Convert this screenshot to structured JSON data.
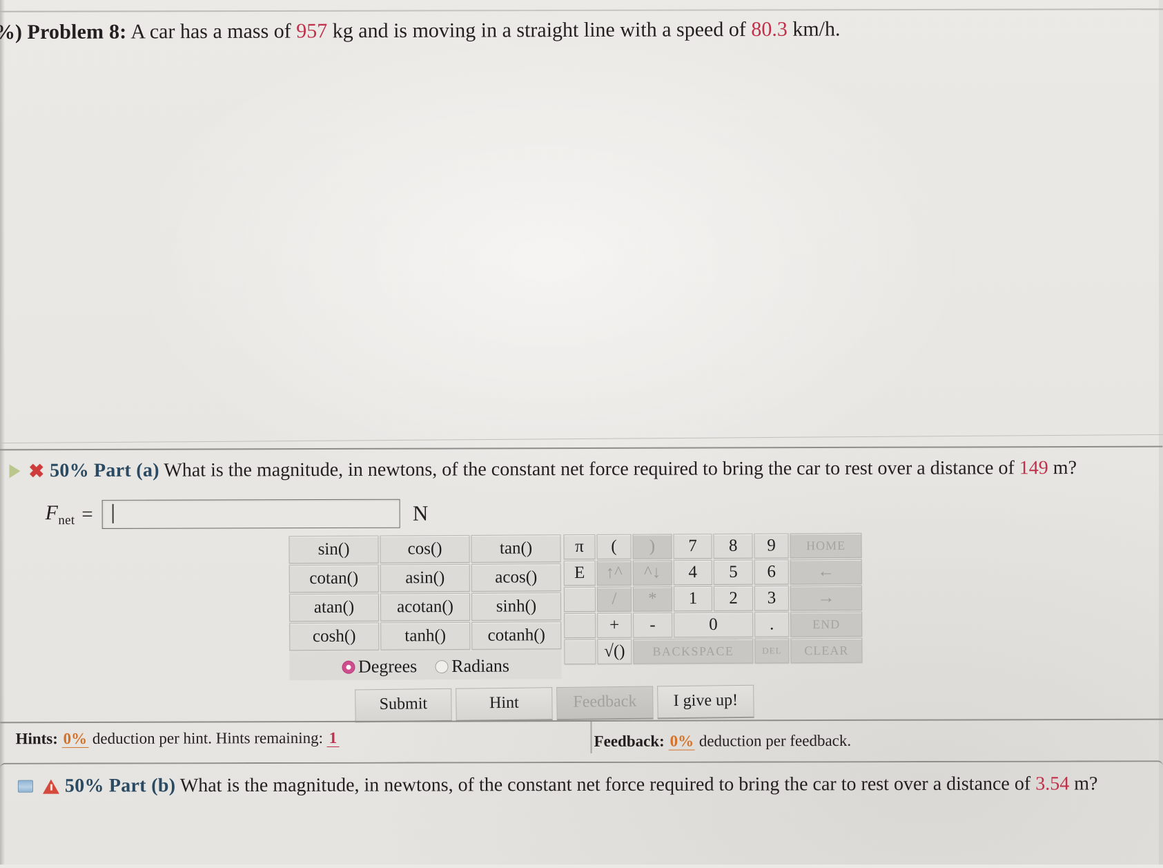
{
  "problem": {
    "percent_prefix": "%)",
    "label": "Problem 8:",
    "text_part1": "A car has a mass of",
    "mass_value": "957",
    "text_part2": "kg and is moving in a straight line with a speed of",
    "speed_value": "80.3",
    "text_part3": "km/h."
  },
  "part_a": {
    "weight": "50%",
    "title": "Part (a)",
    "question_part1": "What is the magnitude, in newtons, of the constant net force required to bring the car to rest over a distance of",
    "distance_value": "149",
    "question_part2": "m?",
    "answer": {
      "label_var": "F",
      "label_sub": "net",
      "equals": "=",
      "value": "",
      "placeholder": "",
      "unit": "N"
    },
    "status_icon": "red-x-icon",
    "expand_icon": "green-triangle-icon"
  },
  "calculator": {
    "functions": [
      [
        "sin()",
        "cos()",
        "tan()"
      ],
      [
        "cotan()",
        "asin()",
        "acos()"
      ],
      [
        "atan()",
        "acotan()",
        "sinh()"
      ],
      [
        "cosh()",
        "tanh()",
        "cotanh()"
      ]
    ],
    "angle_mode": {
      "degrees_label": "Degrees",
      "radians_label": "Radians",
      "selected": "Degrees",
      "selected_color": "#cf4f8e"
    },
    "keypad": [
      [
        "π",
        "(",
        ")",
        "7",
        "8",
        "9",
        "HOME"
      ],
      [
        "E",
        "↑^",
        "^↓",
        "4",
        "5",
        "6",
        "←"
      ],
      [
        "",
        "/",
        "*",
        "1",
        "2",
        "3",
        "→"
      ],
      [
        "",
        "+",
        "-",
        "0",
        ".",
        "END"
      ],
      [
        "",
        "√()",
        "BACKSPACE",
        "DEL",
        "CLEAR"
      ]
    ],
    "keys": {
      "pi": "π",
      "open_paren": "(",
      "close_paren": ")",
      "seven": "7",
      "eight": "8",
      "nine": "9",
      "home": "HOME",
      "e": "E",
      "pow_up": "↑^",
      "pow_down": "^↓",
      "four": "4",
      "five": "5",
      "six": "6",
      "left_arrow": "←",
      "divide": "/",
      "multiply": "*",
      "one": "1",
      "two": "2",
      "three": "3",
      "right_arrow": "→",
      "plus": "+",
      "minus": "-",
      "zero": "0",
      "dot": ".",
      "end": "END",
      "sqrt": "√()",
      "backspace": "BACKSPACE",
      "del": "DEL",
      "clear": "CLEAR"
    }
  },
  "actions": {
    "submit": "Submit",
    "hint": "Hint",
    "feedback": "Feedback",
    "give_up": "I give up!"
  },
  "hints_bar": {
    "hints_label": "Hints:",
    "hints_deduction": "0%",
    "hints_text": "deduction per hint. Hints remaining:",
    "hints_remaining": "1",
    "feedback_label": "Feedback:",
    "feedback_deduction": "0%",
    "feedback_text": "deduction per feedback."
  },
  "part_b": {
    "weight": "50%",
    "title": "Part (b)",
    "question_part1": "What is the magnitude, in newtons, of the constant net force required to bring the car to rest over a distance of",
    "distance_value": "3.54",
    "question_part2": "m?",
    "status_icon": "red-warning-icon",
    "doc_icon": "blue-book-icon"
  },
  "colors": {
    "value_red": "#c0304a",
    "part_tag_blue": "#2a4a63",
    "deduction_orange": "#d4722a",
    "radio_pink": "#cf4f8e"
  }
}
